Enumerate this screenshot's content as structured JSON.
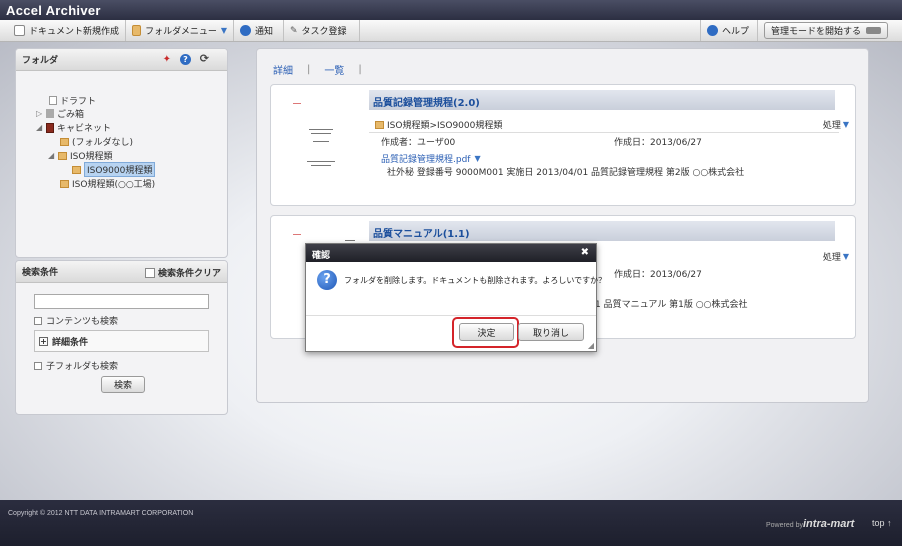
{
  "app": {
    "title": "Accel Archiver"
  },
  "toolbar": {
    "new_doc": "ドキュメント新規作成",
    "folder_menu": "フォルダメニュー",
    "notify": "通知",
    "task": "タスク登録",
    "help": "ヘルプ",
    "admin_mode": "管理モードを開始する"
  },
  "folder_panel": {
    "title": "フォルダ",
    "items": [
      {
        "label": "ドラフト"
      },
      {
        "label": "ごみ箱"
      },
      {
        "label": "キャビネット"
      },
      {
        "label": "(フォルダなし)"
      },
      {
        "label": "ISO規程類"
      },
      {
        "label": "ISO9000規程類"
      },
      {
        "label": "ISO規程類(○○工場)"
      }
    ]
  },
  "search_panel": {
    "title": "検索条件",
    "clear_label": "検索条件クリア",
    "input_value": "",
    "content_search": "コンテンツも検索",
    "detail_label": "詳細条件",
    "subfolder_search": "子フォルダも検索",
    "search_button": "検索"
  },
  "view_tabs": {
    "detail": "詳細",
    "list": "一覧"
  },
  "documents": [
    {
      "title": "品質記録管理規程(2.0)",
      "path": "ISO規程類>ISO9000規程類",
      "action": "処理",
      "author": "作成者：ユーザ00",
      "created": "作成日：2013/06/27",
      "file": "品質記録管理規程.pdf",
      "props": "社外秘  登録番号 9000M001  実施日 2013/04/01 品質記録管理規程 第2版 ○○株式会社"
    },
    {
      "title": "品質マニュアル(1.1)",
      "action": "処理",
      "created": "作成日：2013/06/27",
      "props_partial": "1 品質マニュアル 第1版 ○○株式会社"
    }
  ],
  "dialog": {
    "title": "確認",
    "message": "フォルダを削除します。ドキュメントも削除されます。よろしいですか？",
    "ok": "決定",
    "cancel": "取り消し"
  },
  "footer": {
    "copyright": "Copyright © 2012 NTT DATA INTRAMART CORPORATION",
    "powered": "Powered by",
    "brand": "intra-mart",
    "top": "top ↑"
  },
  "colors": {
    "accent": "#2b5fb4",
    "highlight": "#d4242a",
    "folder": "#e7b96a"
  }
}
